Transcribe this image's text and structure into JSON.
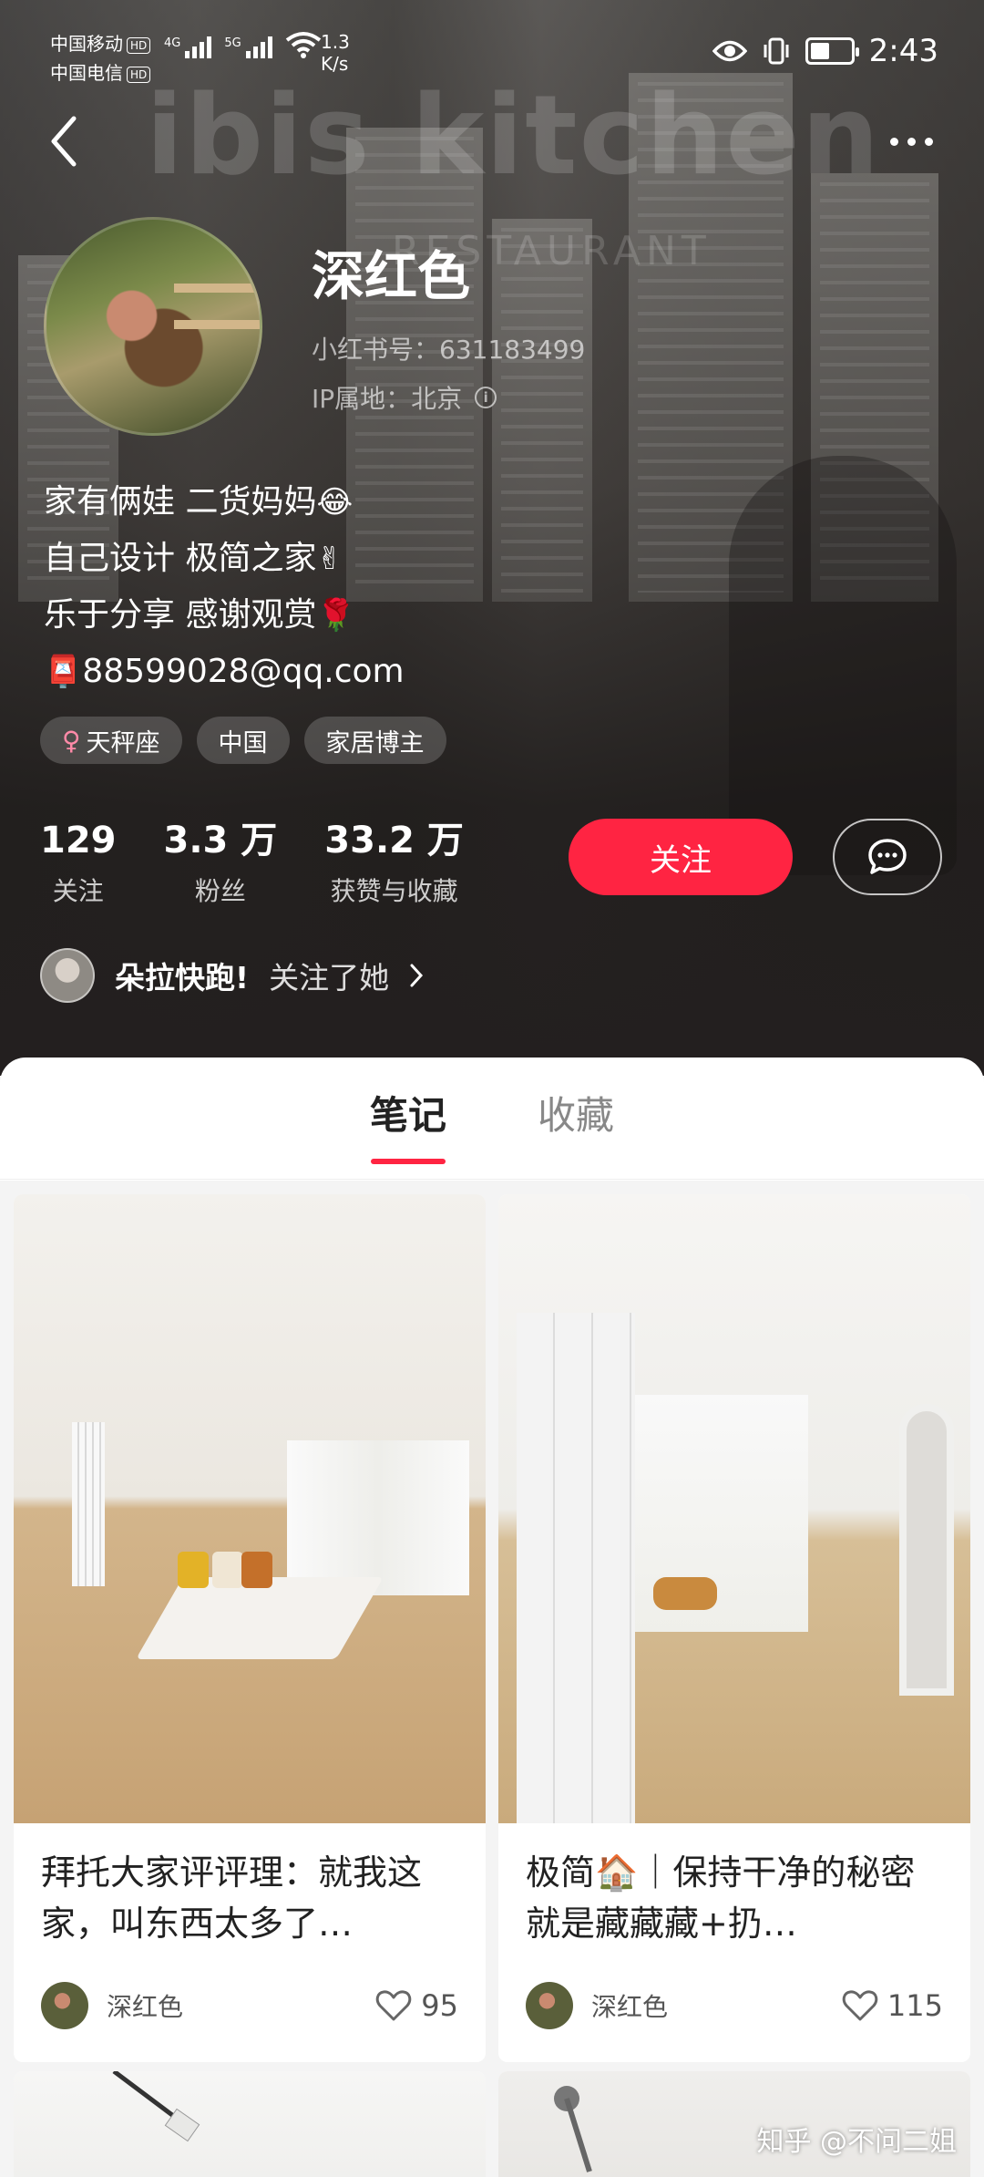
{
  "status_bar": {
    "carrier1": "中国移动",
    "carrier2": "中国电信",
    "hd": "HD",
    "net1": "4G",
    "net2": "5G",
    "speed_value": "1.3",
    "speed_unit": "K/s",
    "time": "2:43"
  },
  "profile": {
    "name": "深红色",
    "id_line": "小红书号：631183499",
    "ip_line": "IP属地：北京",
    "bio": [
      {
        "text": "家有俩娃 二货妈妈",
        "emoji": "😂"
      },
      {
        "text": "自己设计 极简之家",
        "emoji": "✌"
      },
      {
        "text": "乐于分享 感谢观赏",
        "emoji": "🌹"
      },
      {
        "text": "88599028@qq.com",
        "emoji": "📮"
      }
    ],
    "tags": [
      "天秤座",
      "中国",
      "家居博主"
    ],
    "stats": [
      {
        "num": "129",
        "label": "关注"
      },
      {
        "num": "3.3 万",
        "label": "粉丝"
      },
      {
        "num": "33.2 万",
        "label": "获赞与收藏"
      }
    ],
    "follow_label": "关注",
    "mutual": {
      "friend": "朵拉快跑!",
      "action": "关注了她"
    }
  },
  "tabs": [
    "笔记",
    "收藏"
  ],
  "notes": [
    {
      "title": "拜托大家评评理：就我这家，叫东西太多了…",
      "author": "深红色",
      "likes": "95"
    },
    {
      "title": "极简🏠｜保持干净的秘密就是藏藏藏+扔…",
      "author": "深红色",
      "likes": "115"
    }
  ],
  "watermark": "知乎 @不问二姐",
  "colors": {
    "accent": "#ff2442"
  }
}
